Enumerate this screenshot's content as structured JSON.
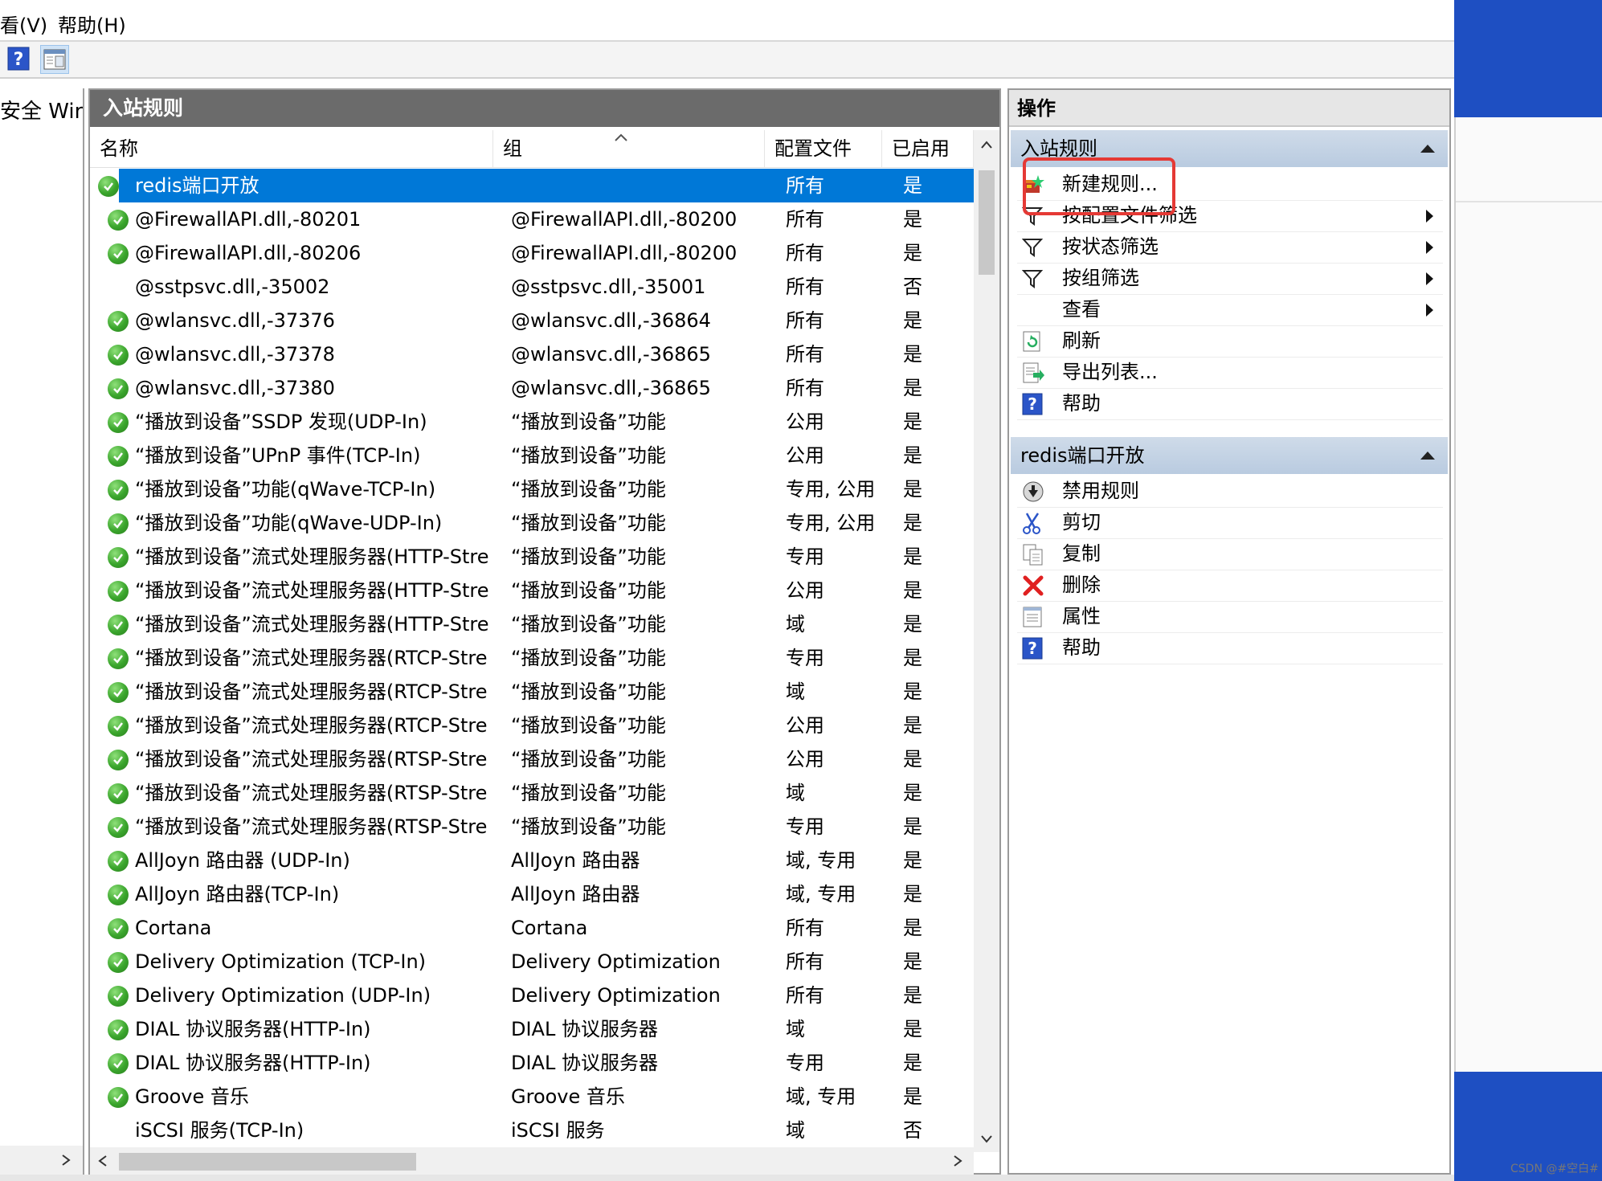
{
  "menu": [
    "看(V)",
    "帮助(H)"
  ],
  "left_pane": {
    "tree_label": "安全 Wind"
  },
  "center": {
    "title": "入站规则",
    "columns": {
      "name": "名称",
      "group": "组",
      "profile": "配置文件",
      "enabled": "已启用"
    },
    "rows": [
      {
        "icon": true,
        "name": "redis端口开放",
        "group": "",
        "profile": "所有",
        "enabled": "是",
        "selected": true
      },
      {
        "icon": true,
        "name": "@FirewallAPI.dll,-80201",
        "group": "@FirewallAPI.dll,-80200",
        "profile": "所有",
        "enabled": "是"
      },
      {
        "icon": true,
        "name": "@FirewallAPI.dll,-80206",
        "group": "@FirewallAPI.dll,-80200",
        "profile": "所有",
        "enabled": "是"
      },
      {
        "icon": false,
        "name": "@sstpsvc.dll,-35002",
        "group": "@sstpsvc.dll,-35001",
        "profile": "所有",
        "enabled": "否"
      },
      {
        "icon": true,
        "name": "@wlansvc.dll,-37376",
        "group": "@wlansvc.dll,-36864",
        "profile": "所有",
        "enabled": "是"
      },
      {
        "icon": true,
        "name": "@wlansvc.dll,-37378",
        "group": "@wlansvc.dll,-36865",
        "profile": "所有",
        "enabled": "是"
      },
      {
        "icon": true,
        "name": "@wlansvc.dll,-37380",
        "group": "@wlansvc.dll,-36865",
        "profile": "所有",
        "enabled": "是"
      },
      {
        "icon": true,
        "name": "“播放到设备”SSDP 发现(UDP-In)",
        "group": "“播放到设备”功能",
        "profile": "公用",
        "enabled": "是"
      },
      {
        "icon": true,
        "name": "“播放到设备”UPnP 事件(TCP-In)",
        "group": "“播放到设备”功能",
        "profile": "公用",
        "enabled": "是"
      },
      {
        "icon": true,
        "name": "“播放到设备”功能(qWave-TCP-In)",
        "group": "“播放到设备”功能",
        "profile": "专用, 公用",
        "enabled": "是"
      },
      {
        "icon": true,
        "name": "“播放到设备”功能(qWave-UDP-In)",
        "group": "“播放到设备”功能",
        "profile": "专用, 公用",
        "enabled": "是"
      },
      {
        "icon": true,
        "name": "“播放到设备”流式处理服务器(HTTP-Stre...",
        "group": "“播放到设备”功能",
        "profile": "专用",
        "enabled": "是"
      },
      {
        "icon": true,
        "name": "“播放到设备”流式处理服务器(HTTP-Stre...",
        "group": "“播放到设备”功能",
        "profile": "公用",
        "enabled": "是"
      },
      {
        "icon": true,
        "name": "“播放到设备”流式处理服务器(HTTP-Stre...",
        "group": "“播放到设备”功能",
        "profile": "域",
        "enabled": "是"
      },
      {
        "icon": true,
        "name": "“播放到设备”流式处理服务器(RTCP-Stre...",
        "group": "“播放到设备”功能",
        "profile": "专用",
        "enabled": "是"
      },
      {
        "icon": true,
        "name": "“播放到设备”流式处理服务器(RTCP-Stre...",
        "group": "“播放到设备”功能",
        "profile": "域",
        "enabled": "是"
      },
      {
        "icon": true,
        "name": "“播放到设备”流式处理服务器(RTCP-Stre...",
        "group": "“播放到设备”功能",
        "profile": "公用",
        "enabled": "是"
      },
      {
        "icon": true,
        "name": "“播放到设备”流式处理服务器(RTSP-Stre...",
        "group": "“播放到设备”功能",
        "profile": "公用",
        "enabled": "是"
      },
      {
        "icon": true,
        "name": "“播放到设备”流式处理服务器(RTSP-Stre...",
        "group": "“播放到设备”功能",
        "profile": "域",
        "enabled": "是"
      },
      {
        "icon": true,
        "name": "“播放到设备”流式处理服务器(RTSP-Stre...",
        "group": "“播放到设备”功能",
        "profile": "专用",
        "enabled": "是"
      },
      {
        "icon": true,
        "name": "AllJoyn 路由器 (UDP-In)",
        "group": "AllJoyn 路由器",
        "profile": "域, 专用",
        "enabled": "是"
      },
      {
        "icon": true,
        "name": "AllJoyn 路由器(TCP-In)",
        "group": "AllJoyn 路由器",
        "profile": "域, 专用",
        "enabled": "是"
      },
      {
        "icon": true,
        "name": "Cortana",
        "group": "Cortana",
        "profile": "所有",
        "enabled": "是"
      },
      {
        "icon": true,
        "name": "Delivery Optimization (TCP-In)",
        "group": "Delivery Optimization",
        "profile": "所有",
        "enabled": "是"
      },
      {
        "icon": true,
        "name": "Delivery Optimization (UDP-In)",
        "group": "Delivery Optimization",
        "profile": "所有",
        "enabled": "是"
      },
      {
        "icon": true,
        "name": "DIAL 协议服务器(HTTP-In)",
        "group": "DIAL 协议服务器",
        "profile": "域",
        "enabled": "是"
      },
      {
        "icon": true,
        "name": "DIAL 协议服务器(HTTP-In)",
        "group": "DIAL 协议服务器",
        "profile": "专用",
        "enabled": "是"
      },
      {
        "icon": true,
        "name": "Groove 音乐",
        "group": "Groove 音乐",
        "profile": "域, 专用",
        "enabled": "是"
      },
      {
        "icon": false,
        "name": "iSCSI 服务(TCP-In)",
        "group": "iSCSI 服务",
        "profile": "域",
        "enabled": "否"
      }
    ]
  },
  "actions": {
    "title": "操作",
    "sections": [
      {
        "title": "入站规则",
        "items": [
          {
            "icon": "new-rule-icon",
            "label": "新建规则...",
            "submenu": false
          },
          {
            "icon": "filter-icon",
            "label": "按配置文件筛选",
            "submenu": true
          },
          {
            "icon": "filter-icon",
            "label": "按状态筛选",
            "submenu": true
          },
          {
            "icon": "filter-icon",
            "label": "按组筛选",
            "submenu": true
          },
          {
            "icon": "",
            "label": "查看",
            "submenu": true
          },
          {
            "icon": "refresh-icon",
            "label": "刷新",
            "submenu": false
          },
          {
            "icon": "export-list-icon",
            "label": "导出列表...",
            "submenu": false
          },
          {
            "icon": "help-icon",
            "label": "帮助",
            "submenu": false
          }
        ]
      },
      {
        "title": "redis端口开放",
        "items": [
          {
            "icon": "disable-rule-icon",
            "label": "禁用规则",
            "submenu": false
          },
          {
            "icon": "cut-icon",
            "label": "剪切",
            "submenu": false
          },
          {
            "icon": "copy-icon",
            "label": "复制",
            "submenu": false
          },
          {
            "icon": "delete-icon",
            "label": "删除",
            "submenu": false
          },
          {
            "icon": "properties-icon",
            "label": "属性",
            "submenu": false
          },
          {
            "icon": "help-icon",
            "label": "帮助",
            "submenu": false
          }
        ]
      }
    ]
  },
  "watermark": "CSDN @#空白#",
  "colors": {
    "selection": "#0078d7",
    "header_dark": "#6b6b6b",
    "section_blue": "#c3d3e6",
    "highlight": "#e53935",
    "desktop_blue": "#1e4fc2"
  }
}
